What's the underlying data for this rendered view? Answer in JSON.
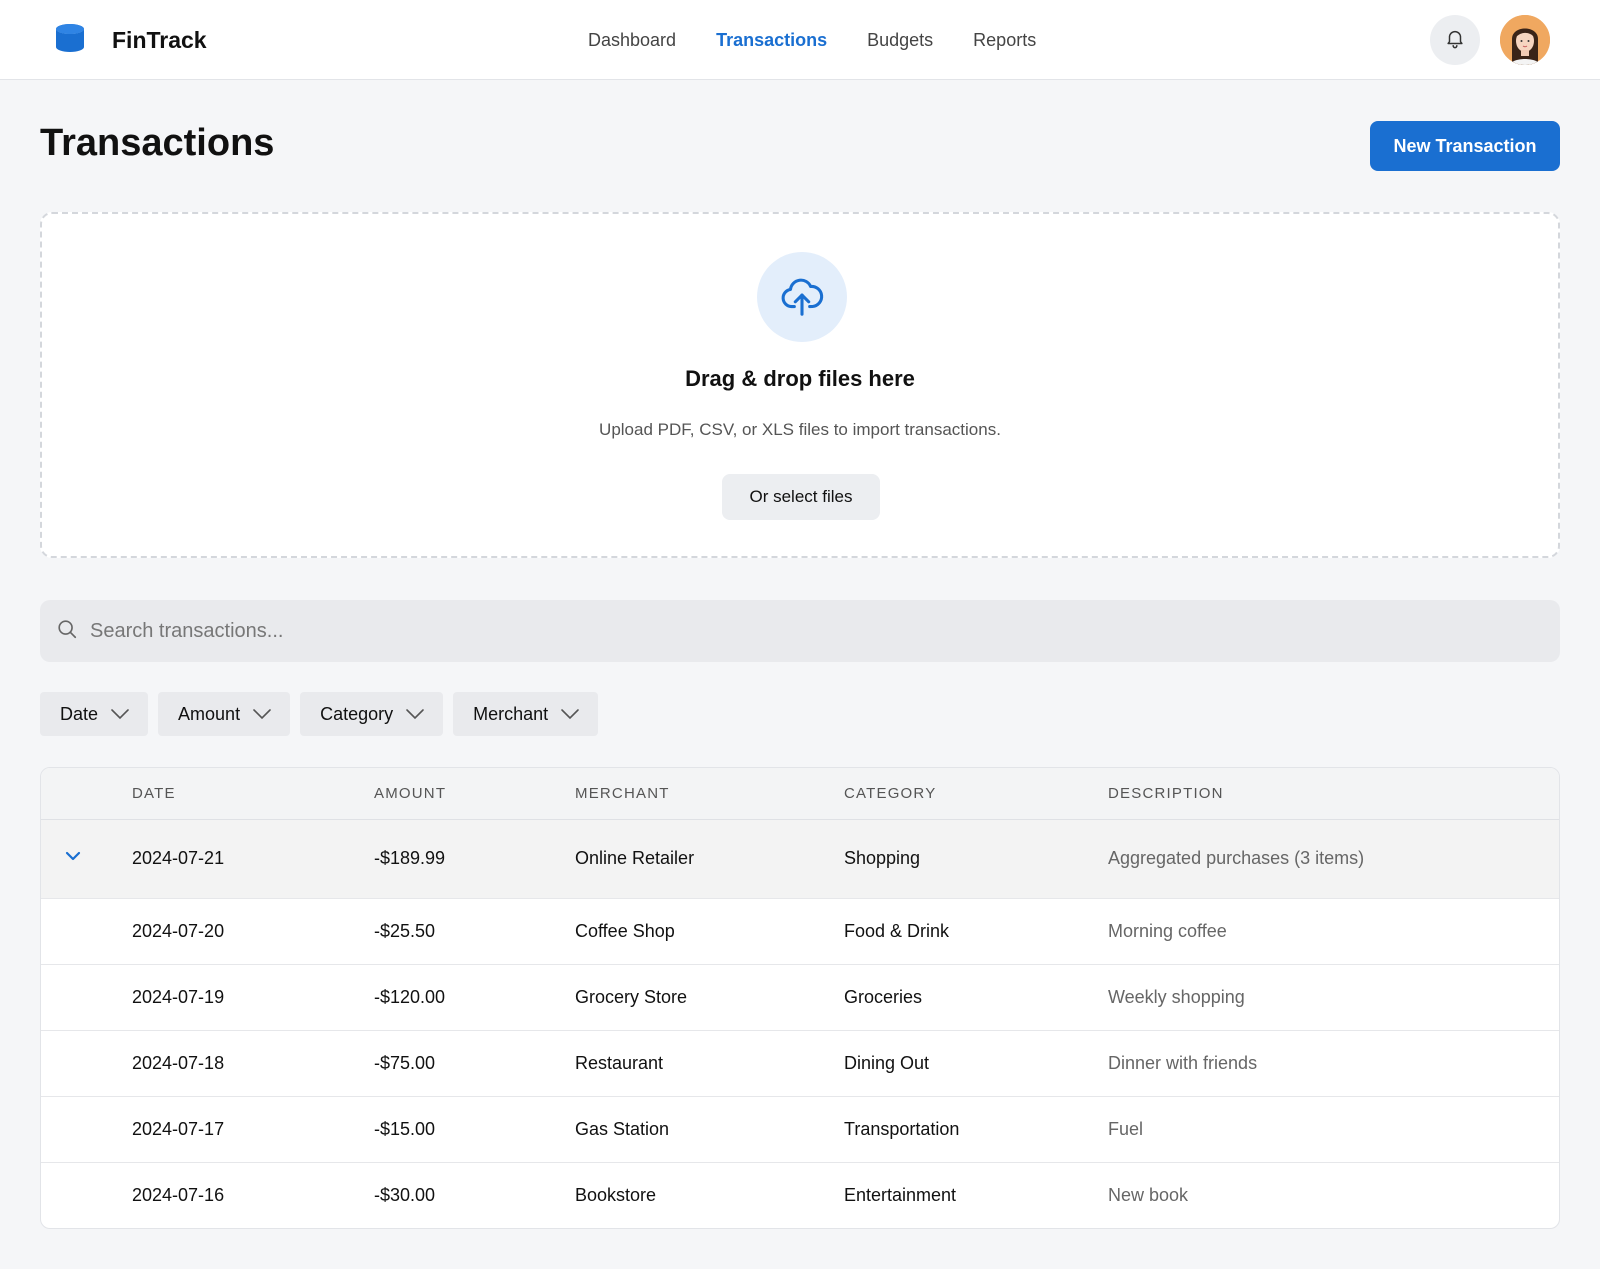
{
  "app": {
    "name": "FinTrack"
  },
  "nav": [
    {
      "label": "Dashboard",
      "active": false
    },
    {
      "label": "Transactions",
      "active": true
    },
    {
      "label": "Budgets",
      "active": false
    },
    {
      "label": "Reports",
      "active": false
    }
  ],
  "icons": {
    "brand": "database-icon",
    "notifications": "bell-icon",
    "upload": "cloud-upload-icon",
    "search": "search-icon",
    "dropdown": "chevron-down-icon",
    "expand": "chevron-down-icon"
  },
  "colors": {
    "accent": "#1a6fd1",
    "background": "#f5f6f8"
  },
  "page": {
    "title": "Transactions",
    "new_button": "New Transaction"
  },
  "dropzone": {
    "title": "Drag & drop files here",
    "subtitle": "Upload PDF, CSV, or XLS files to import transactions.",
    "button": "Or select files"
  },
  "search": {
    "placeholder": "Search transactions..."
  },
  "filters": [
    "Date",
    "Amount",
    "Category",
    "Merchant"
  ],
  "table": {
    "columns": [
      "DATE",
      "AMOUNT",
      "MERCHANT",
      "CATEGORY",
      "DESCRIPTION"
    ],
    "rows": [
      {
        "date": "2024-07-21",
        "amount": "-$189.99",
        "merchant": "Online Retailer",
        "category": "Shopping",
        "description": "Aggregated purchases (3 items)",
        "expandable": true
      },
      {
        "date": "2024-07-20",
        "amount": "-$25.50",
        "merchant": "Coffee Shop",
        "category": "Food & Drink",
        "description": "Morning coffee"
      },
      {
        "date": "2024-07-19",
        "amount": "-$120.00",
        "merchant": "Grocery Store",
        "category": "Groceries",
        "description": "Weekly shopping"
      },
      {
        "date": "2024-07-18",
        "amount": "-$75.00",
        "merchant": "Restaurant",
        "category": "Dining Out",
        "description": "Dinner with friends"
      },
      {
        "date": "2024-07-17",
        "amount": "-$15.00",
        "merchant": "Gas Station",
        "category": "Transportation",
        "description": "Fuel"
      },
      {
        "date": "2024-07-16",
        "amount": "-$30.00",
        "merchant": "Bookstore",
        "category": "Entertainment",
        "description": "New book"
      }
    ]
  }
}
